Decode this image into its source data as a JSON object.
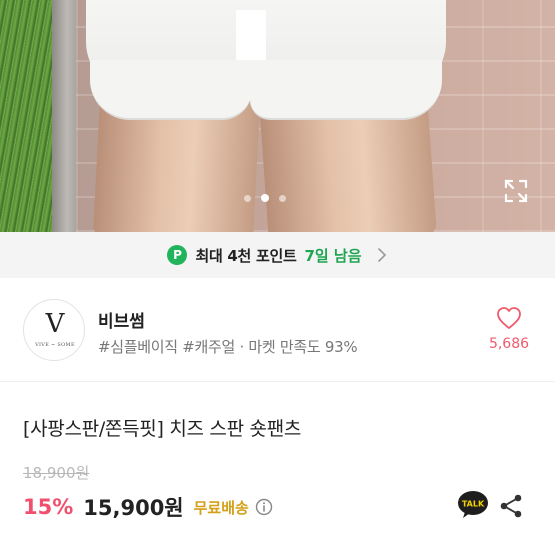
{
  "gallery": {
    "dots": [
      false,
      true,
      false
    ],
    "icons": {
      "expand": "expand-icon"
    }
  },
  "points_banner": {
    "badge": "P",
    "text": "최대 4천 포인트",
    "days": "7일 남음",
    "accent": "#22b45c"
  },
  "shop": {
    "logo_letter": "V",
    "logo_sub": "VIVE ~ SOME",
    "name": "비브썸",
    "tags": "#심플베이직 #캐주얼 · 마켓 만족도 93%",
    "like_count": "5,686",
    "like_color": "#ef5b6b"
  },
  "product": {
    "title": "[사팡스판/쫀득핏] 치즈 스판 숏팬츠",
    "original_price": "18,900원",
    "discount": "15%",
    "price": "15,900원",
    "shipping": "무료배송",
    "discount_color": "#f0506e",
    "shipping_color": "#d4a017"
  },
  "actions": {
    "talk_label": "TALK",
    "icons": [
      "talk-icon",
      "share-icon",
      "info-icon",
      "heart-icon",
      "chevron-right-icon"
    ]
  }
}
